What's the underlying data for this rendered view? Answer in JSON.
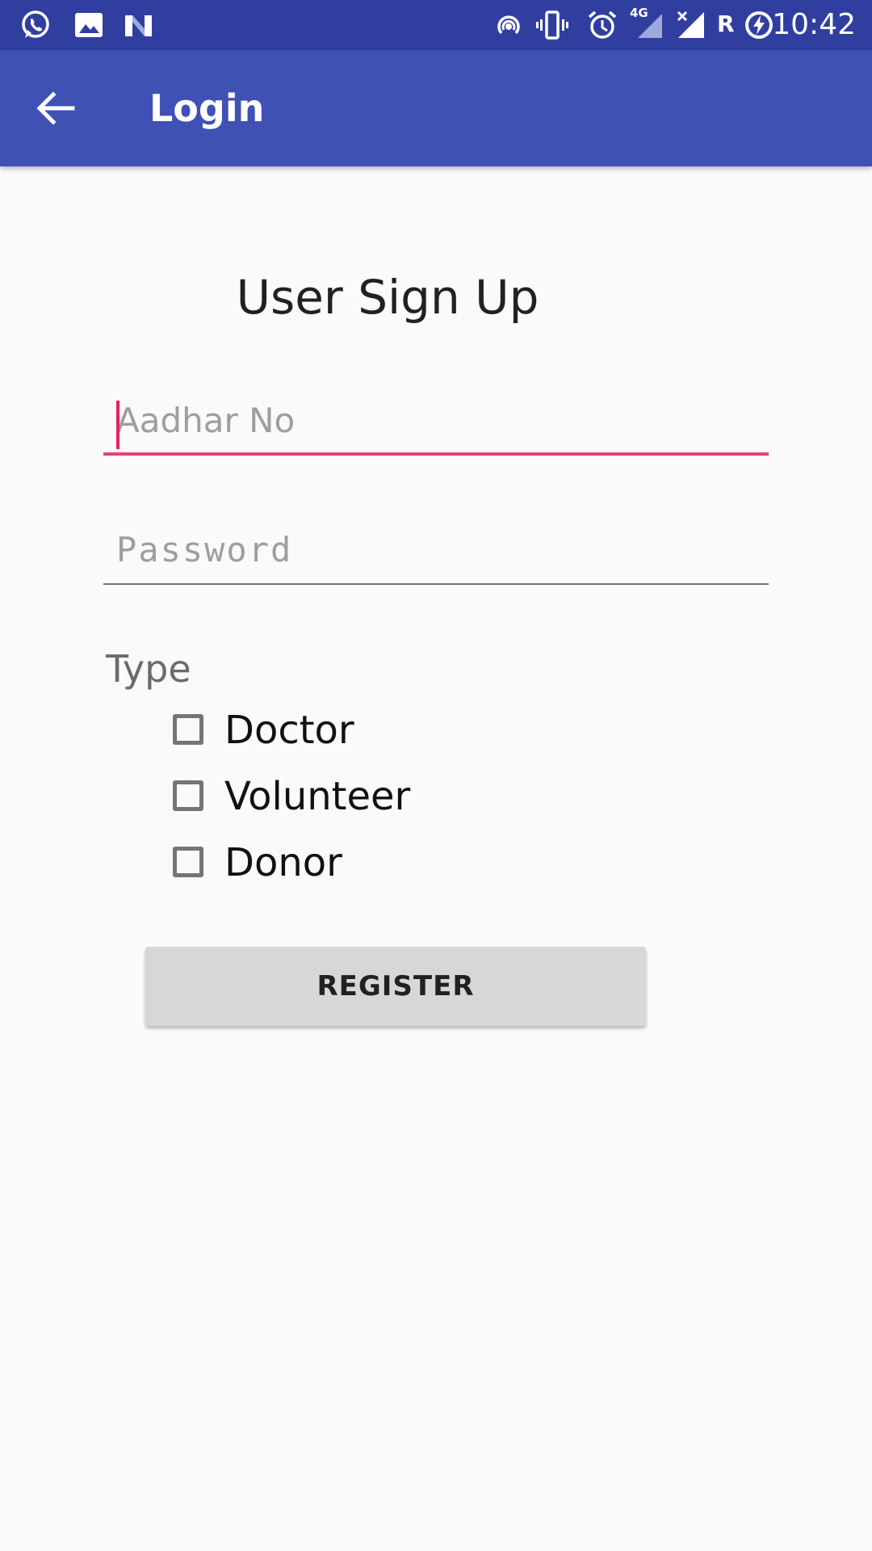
{
  "status_bar": {
    "time": "10:42",
    "left_icons": [
      "whatsapp-icon",
      "gallery-icon",
      "n-logo-icon"
    ],
    "right_icons": [
      "hotspot-icon",
      "vibrate-icon",
      "alarm-icon",
      "signal-4g-icon",
      "signal-no-sim-icon",
      "roaming-icon",
      "battery-charging-icon"
    ],
    "network_label": "4G",
    "roaming_label": "R",
    "color": "#303f9f"
  },
  "app_bar": {
    "title": "Login",
    "back_icon": "arrow-back-icon",
    "color": "#3f51b5"
  },
  "form": {
    "heading": "User Sign Up",
    "aadhar": {
      "placeholder": "Aadhar No",
      "value": ""
    },
    "password": {
      "placeholder": "Password",
      "value": ""
    },
    "type_label": "Type",
    "options": [
      {
        "label": "Doctor",
        "checked": false
      },
      {
        "label": "Volunteer",
        "checked": false
      },
      {
        "label": "Donor",
        "checked": false
      }
    ],
    "register_label": "REGISTER"
  },
  "colors": {
    "accent": "#e91e63",
    "background": "#fafafa",
    "button": "#d6d7d7"
  }
}
